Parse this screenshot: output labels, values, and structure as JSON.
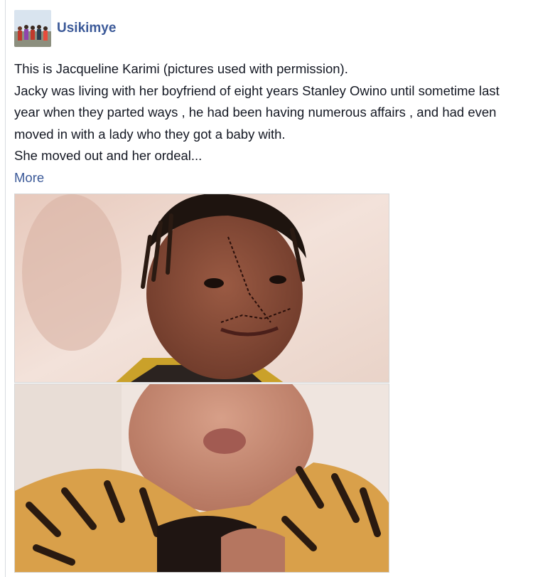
{
  "post": {
    "author": "Usikimye",
    "avatar_icon": "group-photo-avatar",
    "lines": [
      "This is Jacqueline Karimi (pictures used with permission).",
      "Jacky was living with her boyfriend of eight years Stanley Owino until sometime last",
      "year when they parted ways , he had been having numerous affairs , and had even",
      "moved in with a lady who they got a baby with.",
      "She moved out and her ordeal..."
    ],
    "more_label": "More"
  },
  "photos": [
    {
      "icon": "woman-with-stitched-face-photo"
    },
    {
      "icon": "woman-in-tiger-print-top-photo"
    }
  ],
  "colors": {
    "link": "#3b5998",
    "text": "#141823",
    "border": "#d6d6d6"
  }
}
